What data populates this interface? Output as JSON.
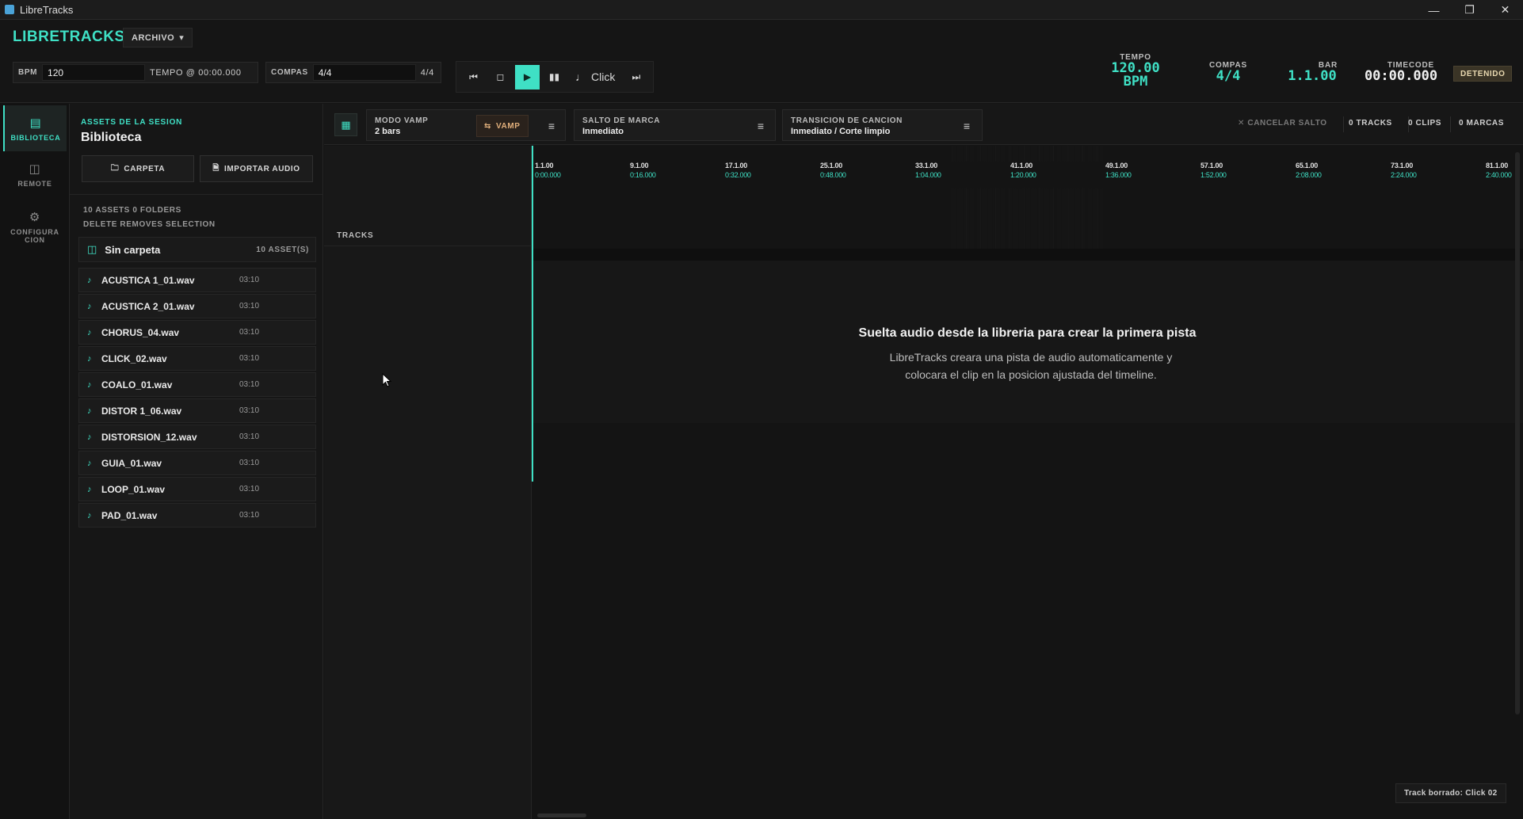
{
  "window": {
    "title": "LibreTracks"
  },
  "topbar": {
    "brand": "LIBRETRACKS",
    "menu_label": "ARCHIVO",
    "bpm_label": "BPM",
    "bpm_value": "120",
    "tempo_at_label": "TEMPO @ 00:00.000",
    "compas_label": "COMPAS",
    "compas_value": "4/4",
    "compas_suffix": "4/4",
    "click_label": "Click",
    "readouts": {
      "tempo_label": "TEMPO",
      "tempo_value": "120.00",
      "tempo_unit": "BPM",
      "compas_label": "COMPAS",
      "compas_value": "4/4",
      "bar_label": "BAR",
      "bar_value": "1.1.00",
      "timecode_label": "TIMECODE",
      "timecode_value": "00:00.000"
    },
    "status": "DETENIDO"
  },
  "rail": {
    "items": [
      {
        "label": "BIBLIOTECA",
        "active": true
      },
      {
        "label": "REMOTE"
      },
      {
        "label": "CONFIGURA CION"
      }
    ]
  },
  "library": {
    "subtitle": "ASSETS DE LA SESION",
    "title": "Biblioteca",
    "folder_button": "CARPETA",
    "import_button": "IMPORTAR AUDIO",
    "stats_line1": "10 ASSETS   0 FOLDERS",
    "stats_line2": "DELETE REMOVES SELECTION",
    "folder_name": "Sin carpeta",
    "folder_count": "10 ASSET(S)",
    "assets": [
      {
        "name": "ACUSTICA 1_01.wav",
        "duration": "03:10"
      },
      {
        "name": "ACUSTICA 2_01.wav",
        "duration": "03:10"
      },
      {
        "name": "CHORUS_04.wav",
        "duration": "03:10"
      },
      {
        "name": "CLICK_02.wav",
        "duration": "03:10"
      },
      {
        "name": "COALO_01.wav",
        "duration": "03:10"
      },
      {
        "name": "DISTOR 1_06.wav",
        "duration": "03:10"
      },
      {
        "name": "DISTORSION_12.wav",
        "duration": "03:10"
      },
      {
        "name": "GUIA_01.wav",
        "duration": "03:10"
      },
      {
        "name": "LOOP_01.wav",
        "duration": "03:10"
      },
      {
        "name": "PAD_01.wav",
        "duration": "03:10"
      }
    ]
  },
  "editor": {
    "vamp": {
      "label": "MODO VAMP",
      "value": "2 bars",
      "button": "VAMP"
    },
    "marker_jump": {
      "label": "SALTO DE MARCA",
      "value": "Inmediato"
    },
    "song_transition": {
      "label": "TRANSICION DE CANCION",
      "value": "Inmediato / Corte limpio"
    },
    "cancel_jump": "CANCELAR SALTO",
    "tracks_count": "0 TRACKS",
    "clips_count": "0 CLIPS",
    "markers_count": "0 MARCAS",
    "tracks_label": "TRACKS",
    "ruler_marks": [
      {
        "bar": "1.1.00",
        "time": "0:00.000"
      },
      {
        "bar": "9.1.00",
        "time": "0:16.000"
      },
      {
        "bar": "17.1.00",
        "time": "0:32.000"
      },
      {
        "bar": "25.1.00",
        "time": "0:48.000"
      },
      {
        "bar": "33.1.00",
        "time": "1:04.000"
      },
      {
        "bar": "41.1.00",
        "time": "1:20.000"
      },
      {
        "bar": "49.1.00",
        "time": "1:36.000"
      },
      {
        "bar": "57.1.00",
        "time": "1:52.000"
      },
      {
        "bar": "65.1.00",
        "time": "2:08.000"
      },
      {
        "bar": "73.1.00",
        "time": "2:24.000"
      },
      {
        "bar": "81.1.00",
        "time": "2:40.000"
      }
    ],
    "drop_title": "Suelta audio desde la libreria para crear la primera pista",
    "drop_text": "LibreTracks creara una pista de audio automaticamente y colocara el clip en la posicion ajustada del timeline.",
    "toast": "Track borrado: Click 02"
  },
  "colors": {
    "accent": "#3fe0c5",
    "background": "#141414",
    "status": "#e9d9b0"
  }
}
